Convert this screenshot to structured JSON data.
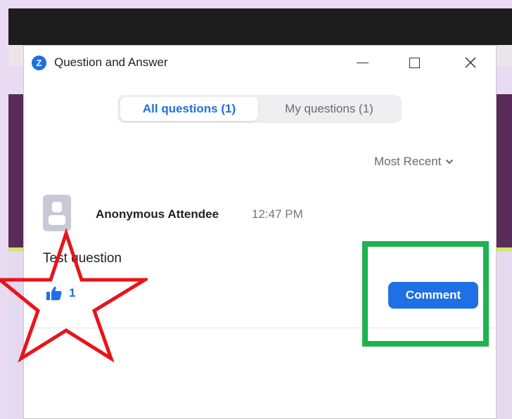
{
  "window": {
    "app_logo_letter": "Z",
    "title": "Question and Answer",
    "icons": [
      "minimize-icon",
      "maximize-icon",
      "close-icon"
    ]
  },
  "tabs": [
    {
      "label": "All questions (1)",
      "selected": true
    },
    {
      "label": "My questions (1)",
      "selected": false
    }
  ],
  "sort": {
    "label": "Most Recent",
    "icon": "chevron-down-icon"
  },
  "question": {
    "author": "Anonymous Attendee",
    "time": "12:47 PM",
    "text": "Test question",
    "likes": "1",
    "comment_label": "Comment"
  },
  "annotations": {
    "star_color": "#e8141a",
    "box_color": "#1db34f"
  },
  "colors": {
    "accent": "#1f6fe5"
  }
}
